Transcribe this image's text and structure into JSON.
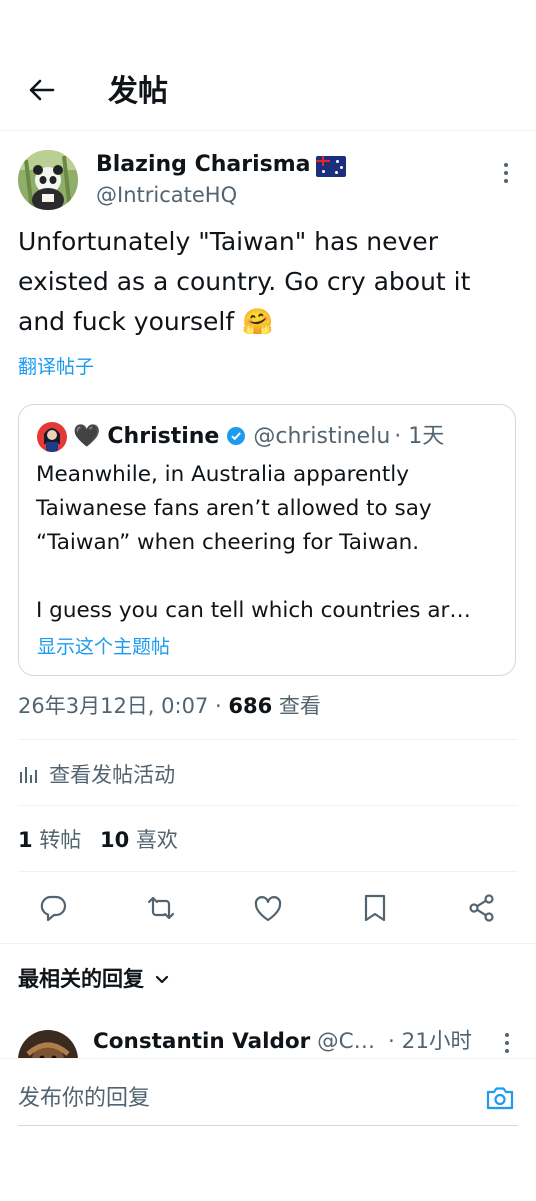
{
  "header": {
    "title": "发帖"
  },
  "post": {
    "author_name": "Blazing Charisma",
    "author_handle": "@IntricateHQ",
    "text_lines": [
      "Unfortunately \"Taiwan\" has never",
      "existed as a country. Go cry about it",
      "and fuck yourself"
    ],
    "emoji": "🤗",
    "translate_label": "翻译帖子",
    "timestamp": "26年3月12日, 0:07",
    "dot": "·",
    "views_count": "686",
    "views_label": "查看",
    "activity_label": "查看发帖活动",
    "reposts_count": "1",
    "reposts_label": "转帖",
    "likes_count": "10",
    "likes_label": "喜欢"
  },
  "quote": {
    "avatar_emoji": "🖤",
    "author_name": "Christine",
    "author_handle": "@christinelu",
    "time": "· 1天",
    "text_lines": [
      "Meanwhile, in Australia apparently",
      "Taiwanese fans aren’t allowed to say",
      "“Taiwan” when cheering for Taiwan."
    ],
    "text_more": "I guess you can tell which countries ar…",
    "show_thread": "显示这个主题帖"
  },
  "replies": {
    "sort_label": "最相关的回复",
    "first_reply": {
      "author_name": "Constantin Valdor",
      "author_handle": "@C…",
      "time": "· 21小时"
    }
  },
  "composer": {
    "placeholder": "发布你的回复"
  },
  "colors": {
    "accent": "#1d9bf0",
    "text": "#0f1419",
    "muted": "#536471",
    "border": "#cfd9de",
    "verified": "#1d9bf0"
  },
  "icons": [
    "back-arrow-icon",
    "more-icon",
    "verified-icon",
    "chart-icon",
    "reply-icon",
    "repost-icon",
    "like-icon",
    "bookmark-icon",
    "share-icon",
    "chevron-down-icon",
    "camera-icon",
    "au-flag-icon"
  ]
}
